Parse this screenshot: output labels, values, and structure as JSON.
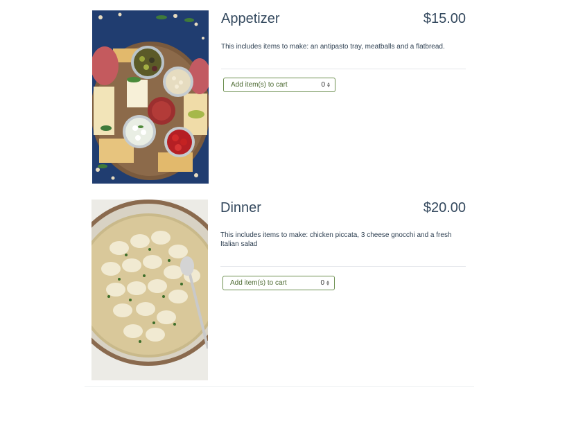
{
  "products": [
    {
      "title": "Appetizer",
      "price": "$15.00",
      "description": "This includes items to make: an antipasto tray, meatballs and a flatbread.",
      "cart_label": "Add item(s) to cart",
      "quantity": "0",
      "image": "antipasto-platter-photo"
    },
    {
      "title": "Dinner",
      "price": "$20.00",
      "description": "This includes items to make: chicken piccata, 3 cheese gnocchi and a fresh Italian salad",
      "cart_label": "Add item(s) to cart",
      "quantity": "0",
      "image": "gnocchi-bowl-photo"
    }
  ],
  "colors": {
    "text": "#34495e",
    "cart_border": "#6b8e4e",
    "cart_text": "#4e6b33",
    "divider": "#e3e6ea"
  }
}
